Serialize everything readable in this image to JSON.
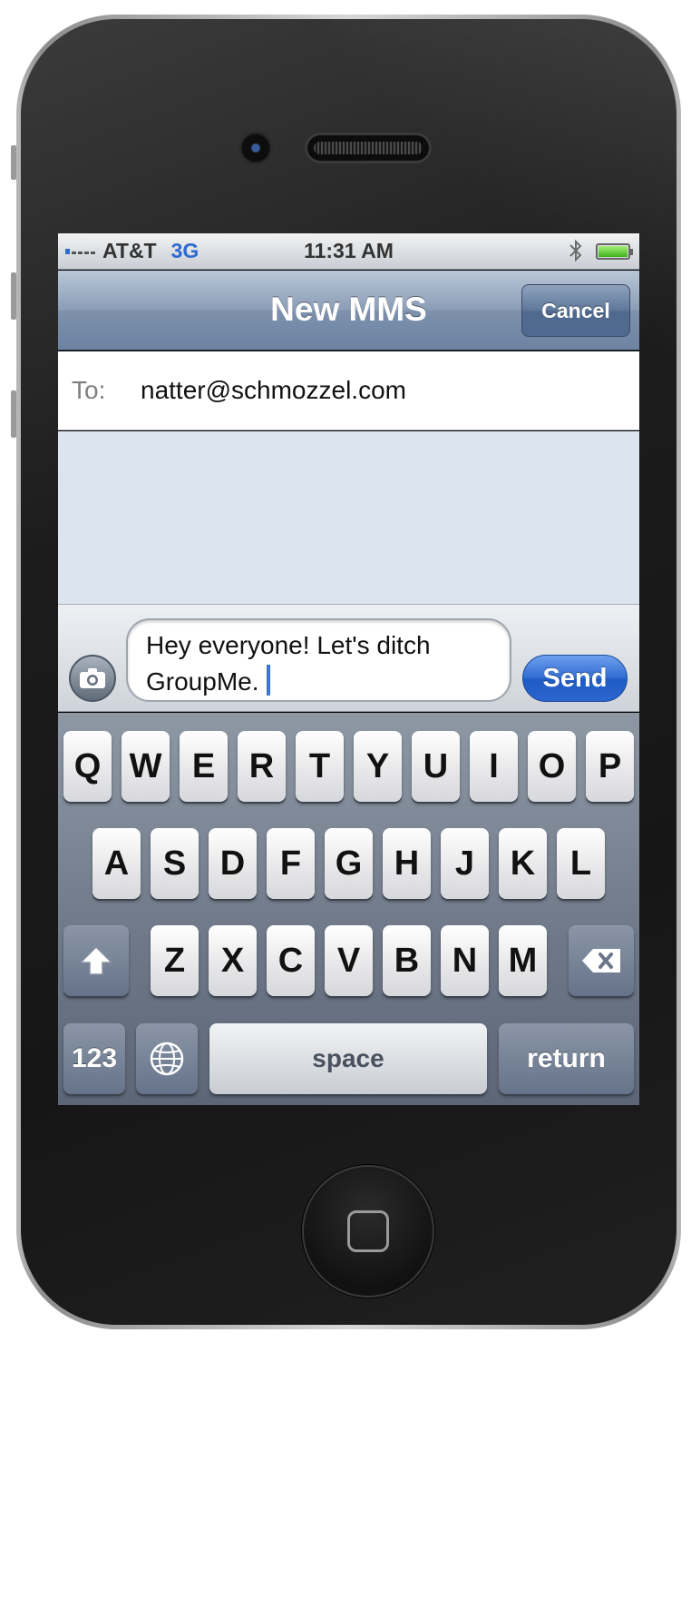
{
  "status_bar": {
    "carrier": "AT&T",
    "network": "3G",
    "time": "11:31 AM",
    "bluetooth_icon": "bluetooth-icon",
    "battery_icon": "battery-icon",
    "signal_bars": 1
  },
  "nav_bar": {
    "title": "New MMS",
    "cancel_label": "Cancel"
  },
  "to_field": {
    "label": "To:",
    "value": "natter@schmozzel.com"
  },
  "compose": {
    "message_line_1": "Hey everyone! Let's ditch",
    "message_line_2": "GroupMe.",
    "send_label": "Send",
    "camera_icon": "camera-icon"
  },
  "keyboard": {
    "row1": [
      "Q",
      "W",
      "E",
      "R",
      "T",
      "Y",
      "U",
      "I",
      "O",
      "P"
    ],
    "row2": [
      "A",
      "S",
      "D",
      "F",
      "G",
      "H",
      "J",
      "K",
      "L"
    ],
    "row3": [
      "Z",
      "X",
      "C",
      "V",
      "B",
      "N",
      "M"
    ],
    "numbers_label": "123",
    "space_label": "space",
    "return_label": "return",
    "shift_icon": "shift-icon",
    "delete_icon": "delete-icon",
    "globe_icon": "globe-icon"
  },
  "colors": {
    "accent_blue": "#2f6ad0",
    "nav_bar": "#8b9db6",
    "conversation_bg": "#dce4ef"
  }
}
